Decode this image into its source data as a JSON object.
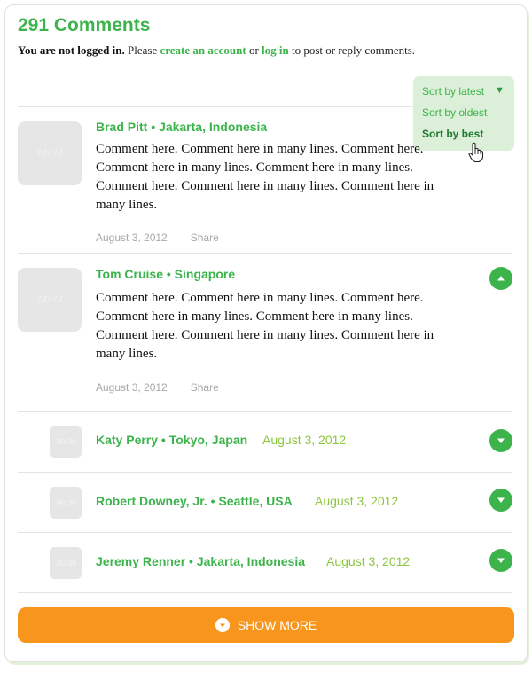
{
  "header": {
    "title": "291 Comments",
    "not_logged": "You are not logged in.",
    "please": " Please ",
    "create_account": "create an account",
    "or": " or ",
    "log_in": "log in",
    "suffix": " to post or reply comments."
  },
  "sort": {
    "options": [
      "Sort by latest",
      "Sort by oldest",
      "Sort by best"
    ],
    "selected": "Sort by best"
  },
  "comments": [
    {
      "avatar_label": "72x72",
      "author": "Brad Pitt",
      "sep": " • ",
      "location": "Jakarta, Indonesia",
      "text": "Comment here. Comment here in many lines. Comment here. Comment here in many lines. Comment here in many lines. Comment here. Comment here in many lines. Comment here in many lines.",
      "date": "August 3, 2012",
      "share": "Share"
    },
    {
      "avatar_label": "72x72",
      "author": "Tom Cruise",
      "sep": " • ",
      "location": "Singapore",
      "text": "Comment here. Comment here in many lines. Comment here. Comment here in many lines. Comment here in many lines. Comment here. Comment here in many lines. Comment here in many lines.",
      "date": "August 3, 2012",
      "share": "Share"
    }
  ],
  "replies": [
    {
      "avatar_label": "36x36",
      "author": "Katy Perry",
      "sep": " • ",
      "location": "Tokyo, Japan",
      "date": "August 3, 2012"
    },
    {
      "avatar_label": "36x36",
      "author": "Robert Downey, Jr.",
      "sep": " • ",
      "location": "Seattle, USA",
      "date": "August 3, 2012"
    },
    {
      "avatar_label": "36x36",
      "author": "Jeremy Renner",
      "sep": " • ",
      "location": "Jakarta, Indonesia",
      "date": "August 3, 2012"
    }
  ],
  "show_more": "SHOW MORE",
  "colors": {
    "accent": "#3cb44b",
    "orange": "#f7951d",
    "sort_bg": "#dcefd8"
  },
  "icons": {
    "collapse": "chevron-up-icon",
    "expand": "chevron-down-icon",
    "cursor": "hand-pointer-icon"
  }
}
